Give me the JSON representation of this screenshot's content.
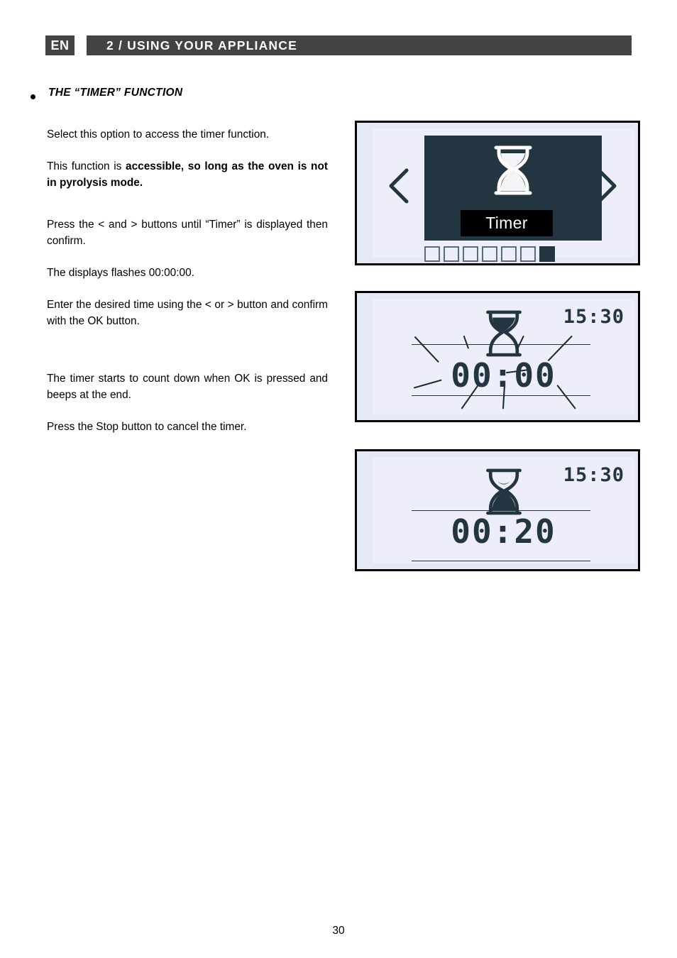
{
  "header": {
    "language_badge": "EN",
    "title": "2 / USING YOUR APPLIANCE",
    "bar_color": "#434343"
  },
  "section": {
    "heading": "THE “TIMER” FUNCTION",
    "bullet": "bullet-dot"
  },
  "body": {
    "p1_plain": "Select this option to access the timer function.",
    "p2_prefix": "This function is ",
    "p2_bold": "accessible, so long as the oven is not in pyrolysis mode.",
    "p3": "Press the < and > buttons until “Timer” is displayed then confirm.",
    "p4": "The displays flashes 00:00:00.",
    "p5": "Enter the desired time using the < or > button and confirm with the OK button.",
    "p6": "The timer starts to count down when OK is pressed and beeps at the end.",
    "p7": "Press the Stop button to cancel the timer."
  },
  "panels": [
    {
      "id": "timer-selection",
      "screen_bg": "#223541",
      "icon": "hourglass-icon",
      "label": "Timer",
      "label_bg": "#000000",
      "nav_left": "chevron-left-icon",
      "nav_right": "chevron-right-icon",
      "pager_total": 7,
      "pager_active_index": 7
    },
    {
      "id": "timer-entry-flashing",
      "clock": "15:30",
      "icon": "hourglass-icon",
      "time_value": "00:00",
      "flashing": "true"
    },
    {
      "id": "timer-counting-down",
      "clock": "15:30",
      "icon": "hourglass-icon",
      "time_value": "00:20",
      "flashing": "false"
    }
  ],
  "colors": {
    "ink": "#223541",
    "panel_outer": "#e5e9f6",
    "panel_inner": "#eeeefa",
    "black": "#000000"
  },
  "footer": {
    "page_number": "30"
  }
}
